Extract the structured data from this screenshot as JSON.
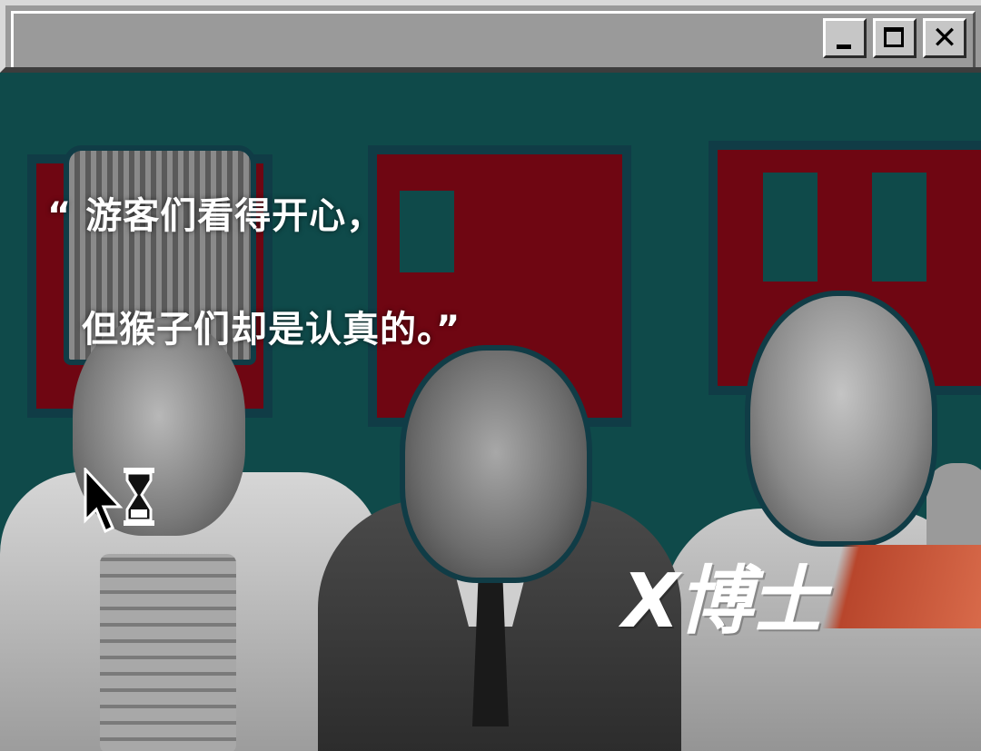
{
  "window": {
    "controls": {
      "minimize_icon": "minimize-icon",
      "maximize_icon": "maximize-icon",
      "close_icon": "close-icon",
      "close_glyph": "✕"
    }
  },
  "content": {
    "quote_line_1": "“ 游客们看得开心，",
    "quote_line_2": "但猴子们却是认真的。”",
    "brand": "X博士",
    "cursor_icon": "busy-cursor-icon"
  },
  "colors": {
    "background_teal": "#0f4a4a",
    "poster_red": "#6f0612",
    "titlebar_gray": "#9a9a9a",
    "brand_accent": "#d86a4a"
  }
}
